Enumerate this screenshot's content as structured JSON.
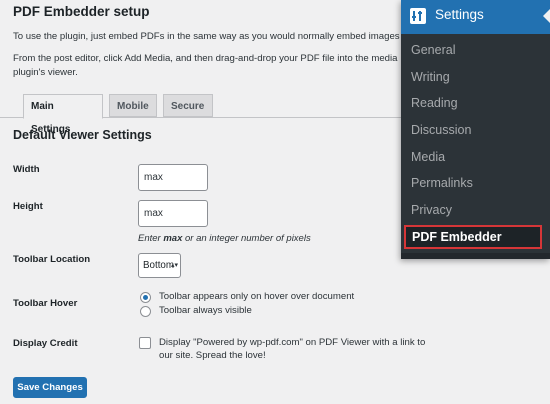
{
  "page": {
    "title": "PDF Embedder setup",
    "intro_line1": "To use the plugin, just embed PDFs in the same way as you would normally embed images in",
    "intro_line2": "From the post editor, click Add Media, and then drag-and-drop your PDF file into the media",
    "intro_line3": "plugin's viewer."
  },
  "tabs": [
    {
      "label": "Main Settings",
      "active": true
    },
    {
      "label": "Mobile",
      "active": false
    },
    {
      "label": "Secure",
      "active": false
    }
  ],
  "section_title": "Default Viewer Settings",
  "width": {
    "label": "Width",
    "value": "max"
  },
  "height": {
    "label": "Height",
    "value": "max"
  },
  "dimension_hint": {
    "prefix": "Enter ",
    "bold": "max",
    "suffix": " or an integer number of pixels"
  },
  "toolbar_location": {
    "label": "Toolbar Location",
    "selected": "Bottom"
  },
  "toolbar_hover": {
    "label": "Toolbar Hover",
    "options": [
      {
        "label": "Toolbar appears only on hover over document",
        "checked": true
      },
      {
        "label": "Toolbar always visible",
        "checked": false
      }
    ]
  },
  "display_credit": {
    "label": "Display Credit",
    "text": "Display \"Powered by wp-pdf.com\" on PDF Viewer with a link to our site. Spread the love!",
    "checked": false
  },
  "save_button": "Save Changes",
  "settings_menu": {
    "header": "Settings",
    "header_icon": "settings-sliders-icon",
    "items": [
      "General",
      "Writing",
      "Reading",
      "Discussion",
      "Media",
      "Permalinks",
      "Privacy",
      "PDF Embedder"
    ],
    "current": "PDF Embedder"
  },
  "colors": {
    "accent": "#2271b1",
    "menu_bg": "#2c3338",
    "highlight_border": "#d63638"
  }
}
